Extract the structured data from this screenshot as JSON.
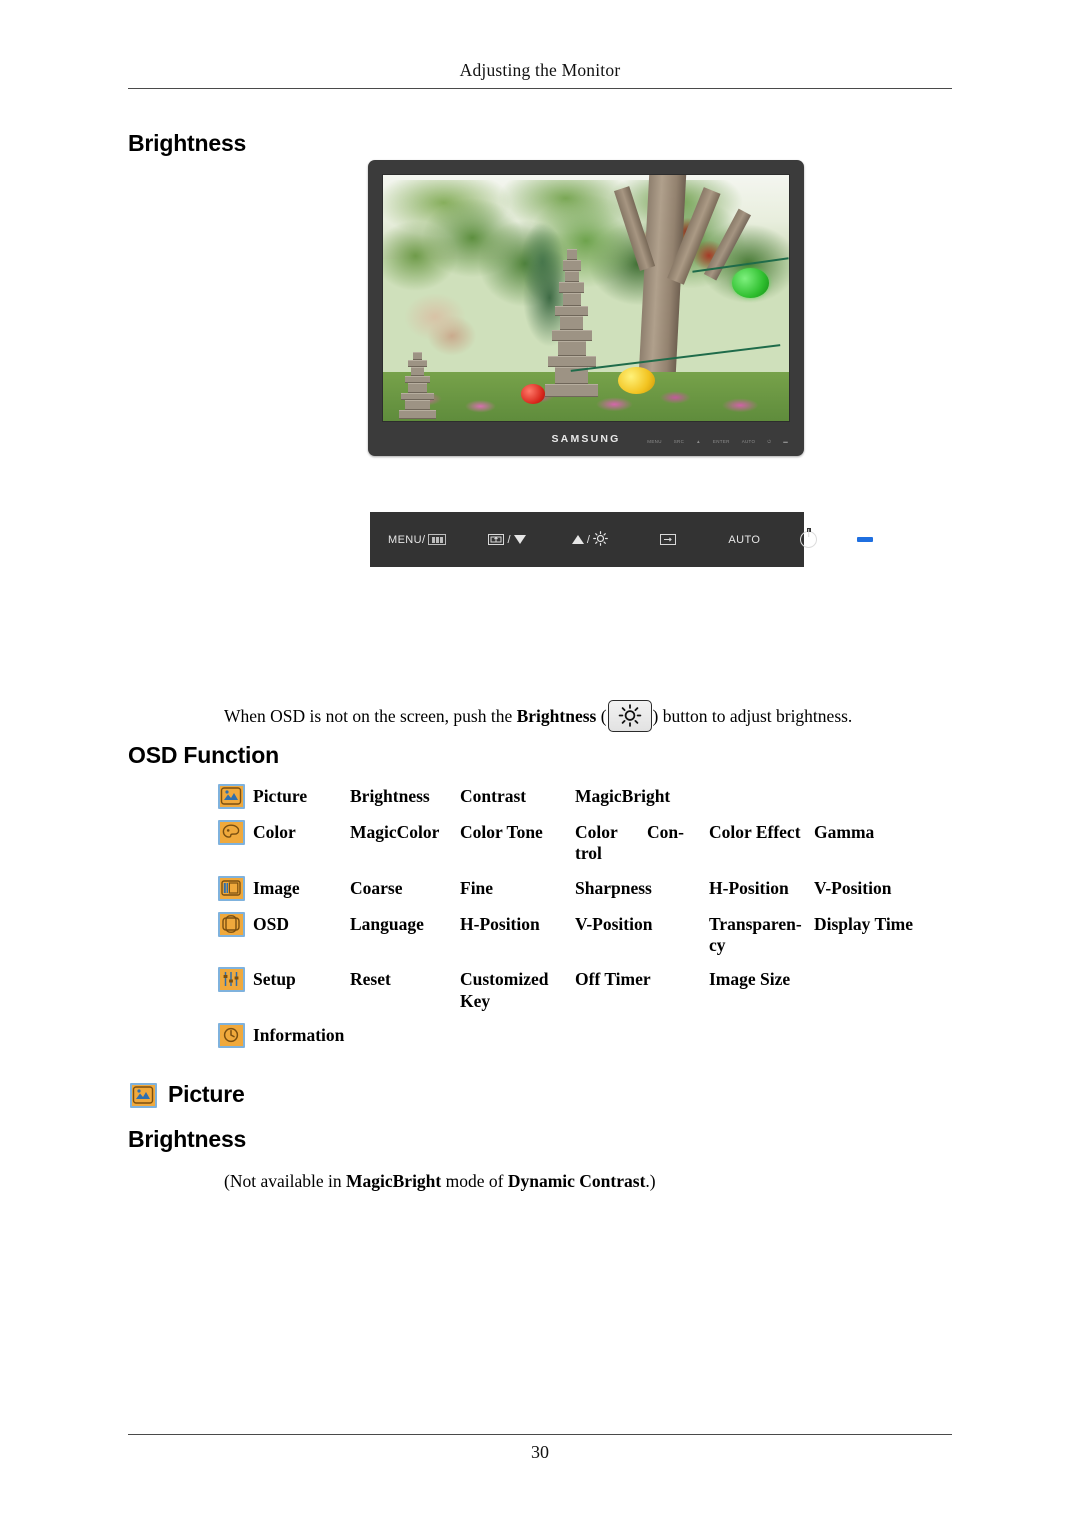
{
  "header": {
    "running_head": "Adjusting the Monitor"
  },
  "sections": {
    "brightness_heading": "Brightness",
    "osd_function_heading": "OSD Function",
    "picture_heading": "Picture",
    "brightness_heading_2": "Brightness"
  },
  "monitor": {
    "brand": "SAMSUNG",
    "bezel_key_labels": [
      "MENU",
      "SRC",
      "▲",
      "ENTER",
      "AUTO",
      "⏻",
      "▬"
    ],
    "screen_alt": "garden scene with stone pagodas, trees and paper lanterns"
  },
  "control_strip": {
    "menu_label": "MENU/",
    "menu_glyph_name": "osd-bars-icon",
    "source_glyph_name": "source-icon",
    "down_glyph_name": "triangle-down-icon",
    "up_glyph_name": "triangle-up-icon",
    "brightness_glyph_name": "sun-icon",
    "enter_glyph_name": "enter-icon",
    "auto_label": "AUTO",
    "power_glyph_name": "power-icon",
    "led_glyph_name": "power-led-indicator",
    "separator": "/"
  },
  "paragraphs": {
    "when_osd_prefix": "When OSD is not on the screen, push the ",
    "when_osd_bold": "Brightness",
    "when_osd_open_paren": " (",
    "when_osd_close_paren": ") ",
    "when_osd_suffix": "button to adjust brightness.",
    "not_available_prefix": "(Not available in ",
    "not_available_bold1": "MagicBright",
    "not_available_mid": " mode of ",
    "not_available_bold2": "Dynamic Contrast",
    "not_available_suffix": ".)"
  },
  "osd_table": {
    "rows": [
      {
        "icon": "picture-icon",
        "category": "Picture",
        "items": [
          "Brightness",
          "Contrast",
          "MagicBright",
          "",
          "",
          ""
        ]
      },
      {
        "icon": "color-palette-icon",
        "category": "Color",
        "items": [
          "MagicColor",
          "Color Tone",
          "Color",
          "Con-",
          "Color Effect",
          "Gamma"
        ],
        "wrap_extra": "trol",
        "wrap_index": 2
      },
      {
        "icon": "image-icon",
        "category": "Image",
        "items": [
          "Coarse",
          "Fine",
          "Sharpness",
          "",
          "H-Position",
          "V-Position"
        ]
      },
      {
        "icon": "osd-icon",
        "category": "OSD",
        "items": [
          "Language",
          "H-Position",
          "V-Position",
          "",
          "Transparen-",
          "Display Time"
        ],
        "wrap_extra": "cy",
        "wrap_index": 4
      },
      {
        "icon": "setup-sliders-icon",
        "category": "Setup",
        "items": [
          "Reset",
          "Customized",
          "Off Timer",
          "",
          "Image Size",
          ""
        ],
        "wrap_extra": "Key",
        "wrap_index": 1
      },
      {
        "icon": "information-clock-icon",
        "category": "Information",
        "items": [
          "",
          "",
          "",
          "",
          "",
          ""
        ]
      }
    ]
  },
  "footer": {
    "page_number": "30"
  },
  "colors": {
    "icon_fill": "#f0a93c",
    "icon_border": "#7fb2dd",
    "bezel": "#3b3b3b",
    "control_strip": "#333333",
    "led": "#1f6fe0",
    "rule": "#4a4a4a"
  }
}
